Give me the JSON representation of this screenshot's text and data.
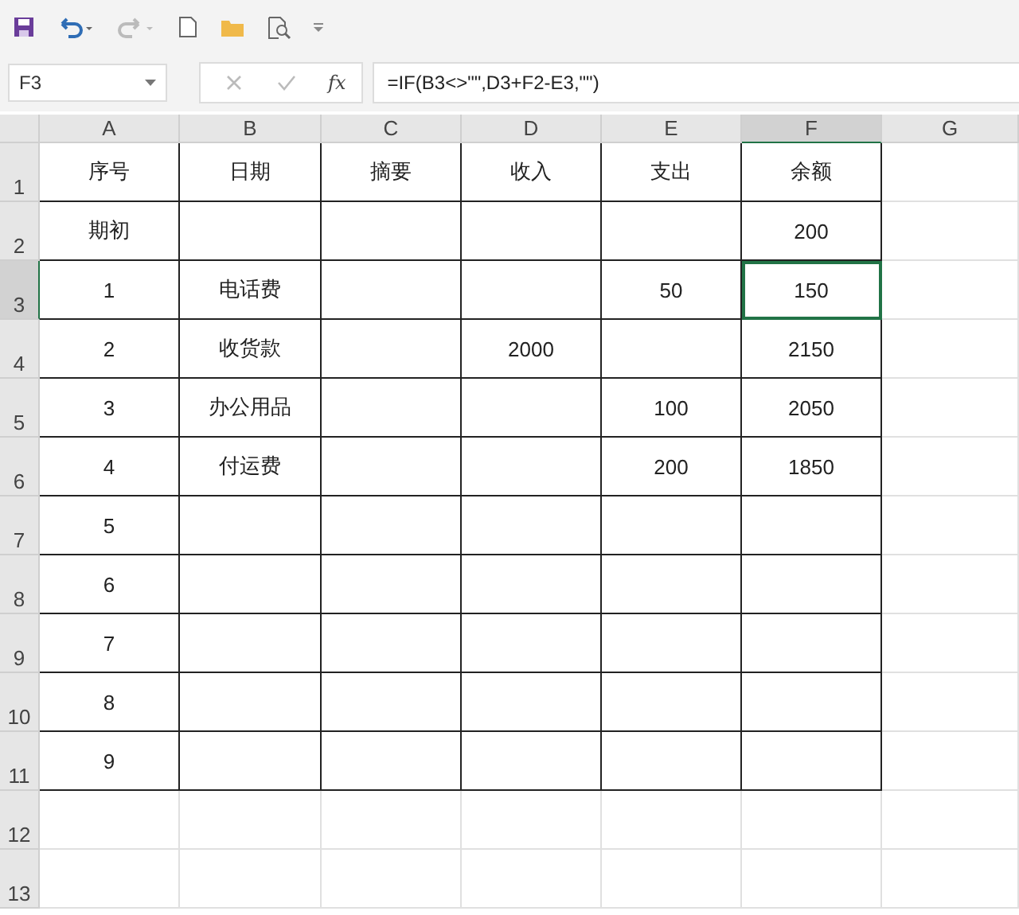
{
  "toolbar": {
    "undo_enabled": true,
    "redo_enabled": false
  },
  "formula_bar": {
    "name_box": "F3",
    "function_label": "fx",
    "formula": "=IF(B3<>\"\",D3+F2-E3,\"\")"
  },
  "columns": [
    {
      "label": "A",
      "selected": false,
      "bordered": true
    },
    {
      "label": "B",
      "selected": false,
      "bordered": true
    },
    {
      "label": "C",
      "selected": false,
      "bordered": true
    },
    {
      "label": "D",
      "selected": false,
      "bordered": true
    },
    {
      "label": "E",
      "selected": false,
      "bordered": true
    },
    {
      "label": "F",
      "selected": true,
      "bordered": true
    },
    {
      "label": "G",
      "selected": false,
      "bordered": false
    }
  ],
  "rows": [
    {
      "number": "1",
      "selected": false,
      "bordered": true,
      "cells": {
        "A": "序号",
        "B": "日期",
        "C": "摘要",
        "D": "收入",
        "E": "支出",
        "F": "余额"
      }
    },
    {
      "number": "2",
      "selected": false,
      "bordered": true,
      "cells": {
        "A": "期初",
        "F": "200"
      }
    },
    {
      "number": "3",
      "selected": true,
      "bordered": true,
      "cells": {
        "A": "1",
        "B": "电话费",
        "E": "50",
        "F": "150"
      }
    },
    {
      "number": "4",
      "selected": false,
      "bordered": true,
      "cells": {
        "A": "2",
        "B": "收货款",
        "D": "2000",
        "F": "2150"
      }
    },
    {
      "number": "5",
      "selected": false,
      "bordered": true,
      "cells": {
        "A": "3",
        "B": "办公用品",
        "E": "100",
        "F": "2050"
      }
    },
    {
      "number": "6",
      "selected": false,
      "bordered": true,
      "cells": {
        "A": "4",
        "B": "付运费",
        "E": "200",
        "F": "1850"
      }
    },
    {
      "number": "7",
      "selected": false,
      "bordered": true,
      "cells": {
        "A": "5"
      }
    },
    {
      "number": "8",
      "selected": false,
      "bordered": true,
      "cells": {
        "A": "6"
      }
    },
    {
      "number": "9",
      "selected": false,
      "bordered": true,
      "cells": {
        "A": "7"
      }
    },
    {
      "number": "10",
      "selected": false,
      "bordered": true,
      "cells": {
        "A": "8"
      }
    },
    {
      "number": "11",
      "selected": false,
      "bordered": true,
      "cells": {
        "A": "9"
      }
    },
    {
      "number": "12",
      "selected": false,
      "bordered": false,
      "cells": {}
    },
    {
      "number": "13",
      "selected": false,
      "bordered": false,
      "cells": {}
    }
  ]
}
